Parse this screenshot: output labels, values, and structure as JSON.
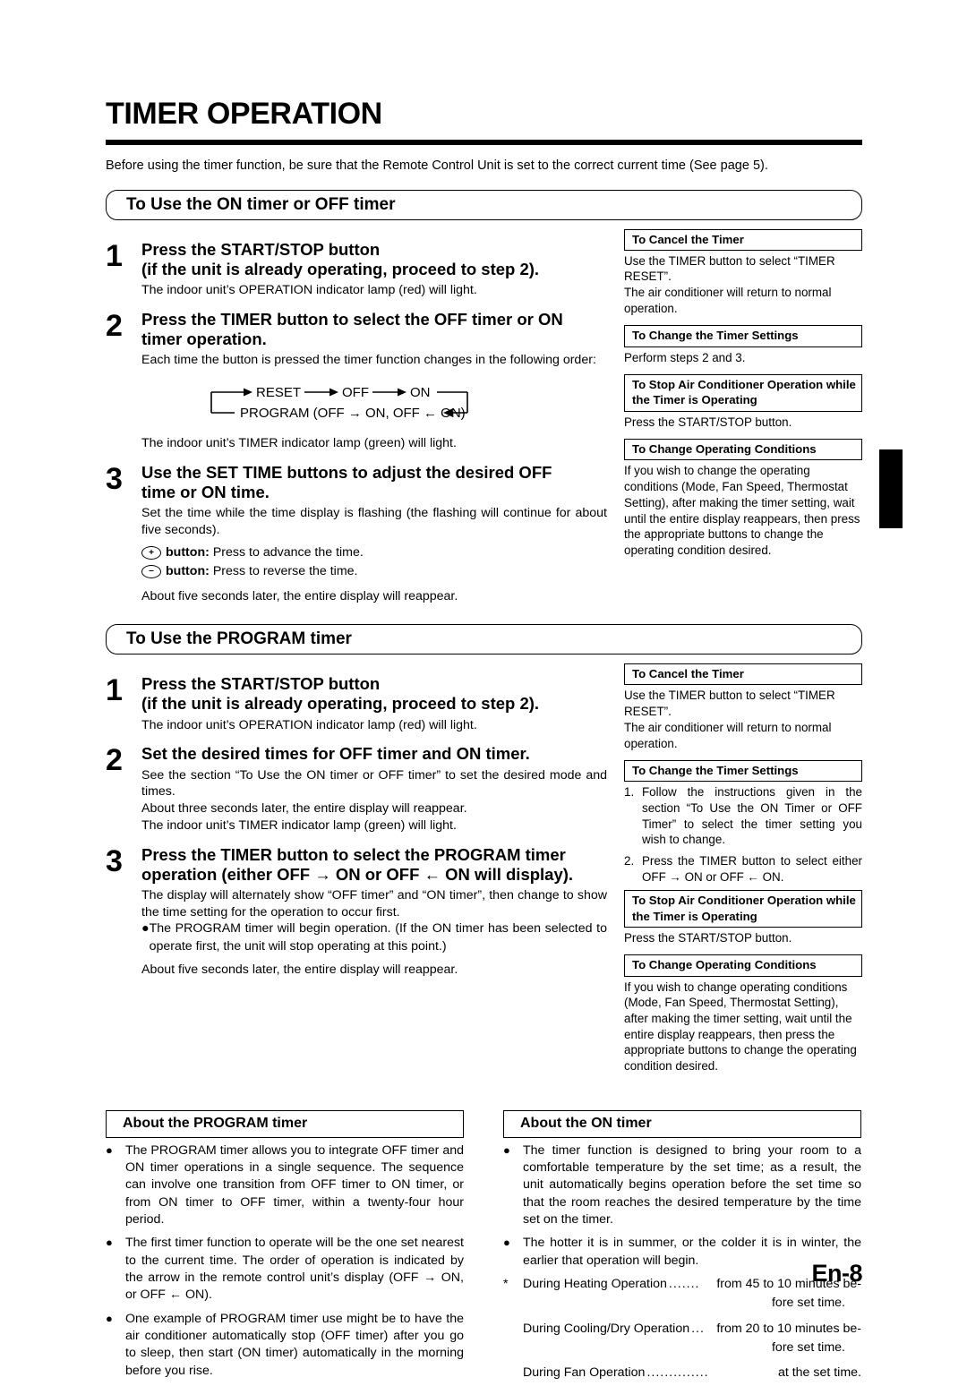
{
  "page": {
    "title": "TIMER OPERATION",
    "intro": "Before using the timer function, be sure that the Remote Control Unit is set to the correct current time (See page 5).",
    "page_number": "En-8"
  },
  "section_on_off": {
    "header": "To Use the ON timer or OFF timer",
    "steps": [
      {
        "num": "1",
        "title_line1": "Press the START/STOP button",
        "title_line2": "(if the unit is already operating, proceed to step 2).",
        "text": "The indoor unit’s OPERATION indicator lamp (red) will light."
      },
      {
        "num": "2",
        "title_line1": "Press the TIMER button to select the OFF timer or ON",
        "title_line2": "timer operation.",
        "text": "Each time the button is pressed the timer function changes in the following order:",
        "after_diagram_text": "The indoor unit’s TIMER indicator lamp (green) will light."
      },
      {
        "num": "3",
        "title_line1": "Use the SET TIME buttons to adjust the desired OFF",
        "title_line2": "time or ON time.",
        "text": "Set the time while the time display is flashing (the flashing will continue for about five seconds).",
        "plus_button_label": "button:",
        "plus_button_text": "Press to advance the time.",
        "minus_button_label": "button:",
        "minus_button_text": "Press to reverse the time.",
        "closing": "About five seconds later, the entire display will reappear."
      }
    ],
    "diagram": {
      "reset": "RESET",
      "off": "OFF",
      "on": "ON",
      "program": "PROGRAM (OFF → ON, OFF ← ON)"
    }
  },
  "section_program": {
    "header": "To Use the PROGRAM timer",
    "steps": [
      {
        "num": "1",
        "title_line1": "Press the START/STOP button",
        "title_line2": "(if the unit is already operating, proceed to step 2).",
        "text": "The indoor unit’s OPERATION indicator lamp (red) will light."
      },
      {
        "num": "2",
        "title_line1": "Set the desired times for OFF timer and ON timer.",
        "title_line2": "",
        "text": "See the section “To Use the ON timer or OFF timer” to set the desired mode and times.",
        "text2": "About three seconds later, the entire display will reappear.",
        "text3": "The indoor unit’s TIMER indicator lamp (green) will light."
      },
      {
        "num": "3",
        "title_line1": "Press the TIMER button to select the PROGRAM timer",
        "title_line2": "operation (either OFF → ON or OFF ← ON will display).",
        "text": "The display will alternately show “OFF timer” and “ON timer”, then change to show the time setting for the operation to occur first.",
        "bullet": "The PROGRAM timer will begin operation. (If the ON timer has been selected to operate first, the unit will stop operating at this point.)",
        "closing": "About five seconds later, the entire display will reappear."
      }
    ]
  },
  "sidebar_on_off": [
    {
      "head": "To Cancel the Timer",
      "body": "Use the TIMER button to select “TIMER RESET”.\nThe air conditioner will return to normal operation."
    },
    {
      "head": "To Change the Timer Settings",
      "body": "Perform steps 2 and 3."
    },
    {
      "head": "To Stop Air Conditioner Operation while the Timer is Operating",
      "body": "Press the START/STOP button."
    },
    {
      "head": "To Change Operating Conditions",
      "body": "If you wish to change the operating conditions (Mode, Fan Speed, Thermostat Setting), after making the timer setting, wait until the entire display reappears, then press the appropriate buttons to change the operating condition desired."
    }
  ],
  "sidebar_program": {
    "cancel": {
      "head": "To Cancel the Timer",
      "body": "Use the TIMER button to select “TIMER RESET”.\nThe air conditioner will return to normal operation."
    },
    "change_settings": {
      "head": "To Change the Timer Settings",
      "items": [
        {
          "n": "1.",
          "t": "Follow the instructions given in the section “To Use the ON Timer or OFF Timer” to select the timer setting you wish to change."
        },
        {
          "n": "2.",
          "t": "Press the TIMER button to select either OFF → ON or OFF ← ON."
        }
      ]
    },
    "stop": {
      "head": "To Stop Air Conditioner Operation while the Timer is Operating",
      "body": "Press the START/STOP button."
    },
    "conditions": {
      "head": "To Change Operating Conditions",
      "body": "If you wish to change operating conditions (Mode, Fan Speed, Thermostat Setting), after making the timer setting, wait until the entire display reappears, then press the appropriate buttons to change the operating condition desired."
    }
  },
  "about_program": {
    "head": "About the PROGRAM timer",
    "bullets": [
      "The PROGRAM timer allows you to integrate OFF timer and ON timer operations in a single sequence. The sequence can involve one transition from OFF timer to ON timer, or from ON timer to OFF timer, within a twenty-four hour period.",
      "The first timer function to operate will be the one set nearest to the current time. The order of operation is indicated by the arrow in the remote control unit’s display (OFF → ON, or OFF ← ON).",
      "One example of PROGRAM timer use might be to have the air conditioner automatically stop (OFF timer) after you go to sleep, then start (ON timer) automatically in the morning before you rise."
    ]
  },
  "about_on": {
    "head": "About the ON timer",
    "bullets": [
      "The timer function is designed to bring your room to a comfortable temperature by the set time; as a result, the unit automatically begins operation before the set time so that the room reaches the desired temperature by the time set on the timer.",
      "The hotter it is in summer, or the colder it is in winter, the earlier that operation will begin."
    ],
    "leaders": [
      {
        "star": "*",
        "label": "During Heating Operation",
        "dots": ".......",
        "value": "from 45 to 10 minutes be-",
        "cont": "fore set time."
      },
      {
        "star": "",
        "label": "During Cooling/Dry Operation",
        "dots": "...",
        "value": "from 20 to 10 minutes be-",
        "cont": "fore set time."
      },
      {
        "star": "",
        "label": "During Fan Operation",
        "dots": "..............",
        "value": "at the set time.",
        "cont": ""
      }
    ]
  }
}
